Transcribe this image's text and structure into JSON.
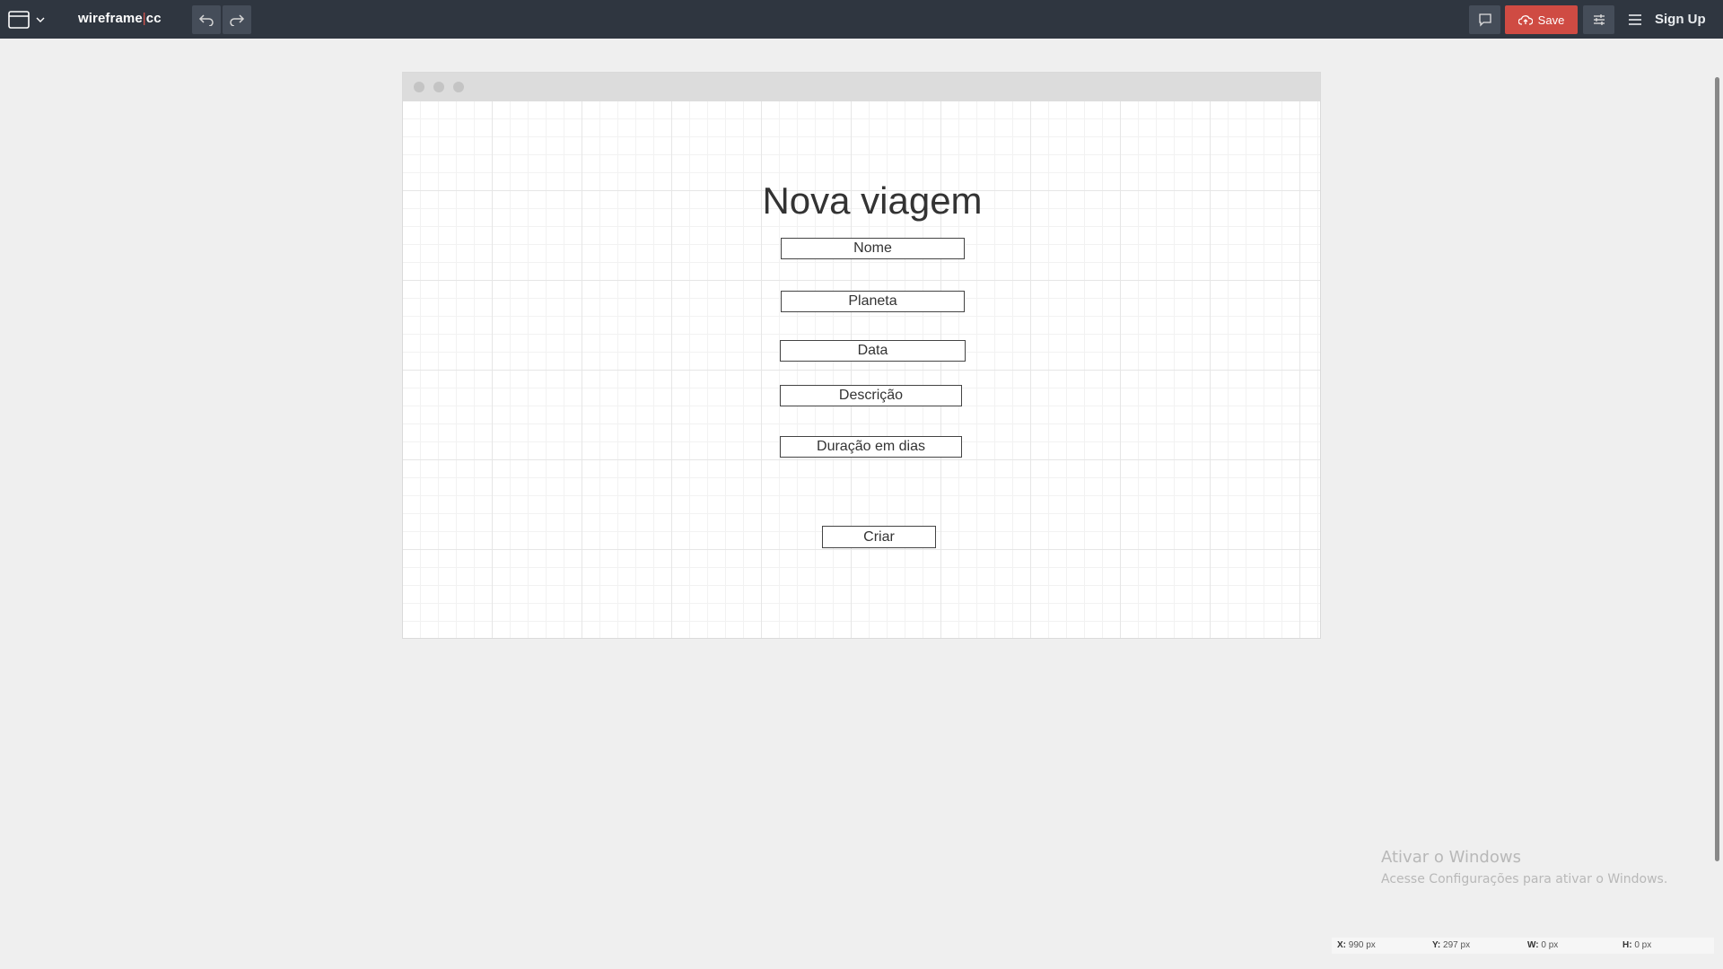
{
  "app": {
    "logo_left": "wireframe",
    "logo_sep": "|",
    "logo_right": "cc",
    "save_label": "Save",
    "signup_label": "Sign Up"
  },
  "icons": {
    "page_menu": "browser-window-icon",
    "dropdown": "chevron-down-icon",
    "undo": "undo-icon",
    "redo": "redo-icon",
    "comment": "comment-icon",
    "save": "cloud-upload-icon",
    "settings": "sliders-icon",
    "menu": "hamburger-menu-icon"
  },
  "colors": {
    "topbar": "#2f3640",
    "save": "#cf4b43",
    "logo_sep": "#e0574f"
  },
  "wireframe": {
    "title": "Nova viagem",
    "fields": [
      {
        "label": "Nome"
      },
      {
        "label": "Planeta"
      },
      {
        "label": "Data"
      },
      {
        "label": "Descrição"
      },
      {
        "label": "Duração em dias"
      }
    ],
    "submit_label": "Criar"
  },
  "watermark": {
    "line1": "Ativar o Windows",
    "line2": "Acesse Configurações para ativar o Windows."
  },
  "status": {
    "x_label": "X:",
    "x_value": "990 px",
    "y_label": "Y:",
    "y_value": "297 px",
    "w_label": "W:",
    "w_value": "0 px",
    "h_label": "H:",
    "h_value": "0 px"
  }
}
